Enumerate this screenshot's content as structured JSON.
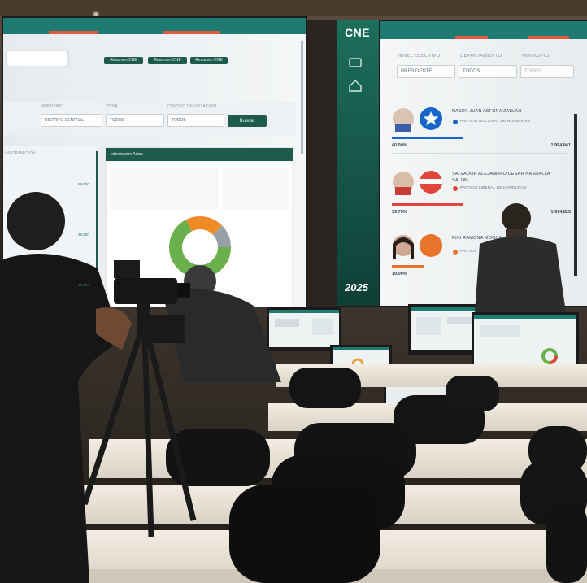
{
  "left_screen": {
    "buttons": [
      "Resumen CNE",
      "Resumen CNE",
      "Resumen CNE"
    ],
    "filter_labels": [
      "MUNICIPIO",
      "ZONA",
      "CENTRO DE VOTACION"
    ],
    "selects": [
      "DISTRITO CENTRAL",
      "TODOS",
      "TODOS"
    ],
    "search_button": "Buscar",
    "side_label": "INFORMACION",
    "info_panel_title": "Informacion Actas",
    "counts": [
      "88,900",
      "48,900",
      "15,000"
    ]
  },
  "right_screen": {
    "filter_labels": [
      "NIVEL ELECTIVO",
      "DEPARTAMENTO",
      "MUNICIPIO"
    ],
    "selects": [
      "PRESIDENTE",
      "TODOS",
      "TODOS"
    ],
    "candidates": [
      {
        "name": "NASRY JUAN ASFURA ZABLAH",
        "party": "PARTIDO NACIONAL DE HONDURAS",
        "percent": "40.00%",
        "votes": "1,994,841"
      },
      {
        "name": "SALVADOR ALEJANDRO CESAR NASRALLA SALUM",
        "party": "PARTIDO LIBERAL DE HONDURAS",
        "percent": "39.75%",
        "votes": "1,974,825"
      },
      {
        "name": "RIXI RAMONA MONCADA GODOY",
        "party": "PARTIDO LIBRE",
        "percent": "19.00%",
        "votes": ""
      }
    ]
  },
  "center_column": {
    "logo_text": "CNE",
    "year_text": "2025"
  },
  "colors": {
    "teal_bar": "#1f7a72",
    "dark_green": "#1f5b4b",
    "nacional_blue": "#1767c9",
    "liberal_red": "#e0463a",
    "libre_orange": "#e8742c",
    "donut_green": "#6ab04c",
    "donut_orange": "#f08a24",
    "donut_gray": "#9aa1a6"
  }
}
